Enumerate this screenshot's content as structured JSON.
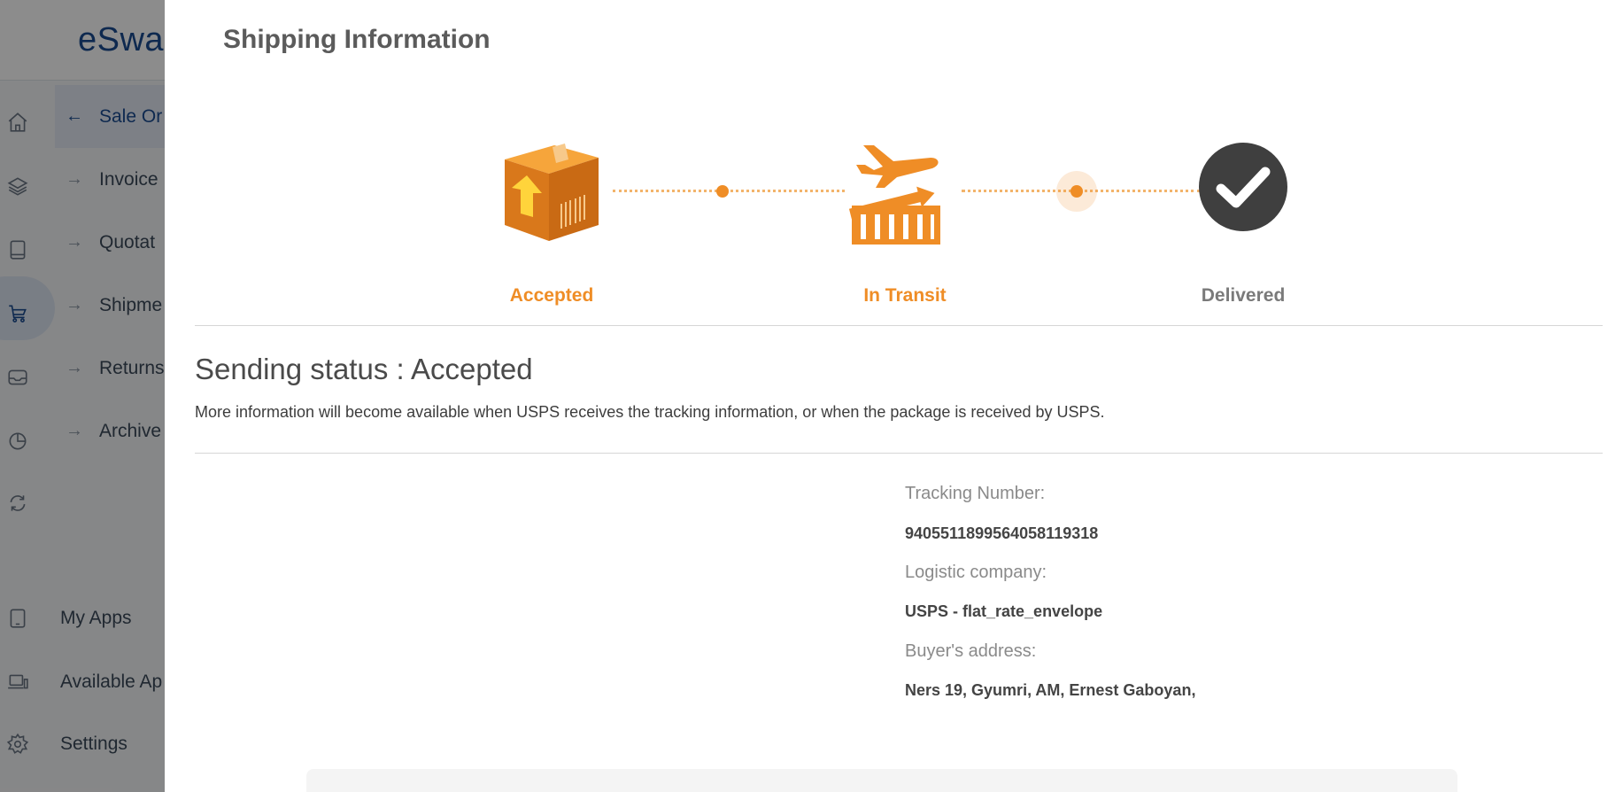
{
  "app": {
    "logo": "eSwa",
    "subnav": [
      {
        "label": "Sale Or",
        "active": true
      },
      {
        "label": "Invoice",
        "active": false
      },
      {
        "label": "Quotat",
        "active": false
      },
      {
        "label": "Shipme",
        "active": false
      },
      {
        "label": "Returns",
        "active": false
      },
      {
        "label": "Archive",
        "active": false
      }
    ],
    "bottom_nav": [
      {
        "label": "My Apps",
        "icon": "tablet-icon"
      },
      {
        "label": "Available Ap",
        "icon": "laptop-icon"
      },
      {
        "label": "Settings",
        "icon": "gear-icon"
      }
    ]
  },
  "modal": {
    "title": "Shipping Information",
    "steps": [
      {
        "label": "Accepted",
        "icon": "package-icon",
        "color": "#ef8d26"
      },
      {
        "label": "In Transit",
        "icon": "airplane-cargo-icon",
        "color": "#ef8d26"
      },
      {
        "label": "Delivered",
        "icon": "check-circle-icon",
        "color": "#6b6b6b"
      }
    ],
    "status_title": "Sending status : Accepted",
    "status_description": "More information will become available when USPS receives the tracking information, or when the package is received by USPS.",
    "details": {
      "tracking_label": "Tracking Number:",
      "tracking_value": "9405511899564058119318",
      "logistic_label": "Logistic company:",
      "logistic_value": "USPS - flat_rate_envelope",
      "address_label": "Buyer's address:",
      "address_value": "Ners 19, Gyumri, AM, Ernest Gaboyan,"
    }
  },
  "colors": {
    "accent": "#ef8d26",
    "brand": "#1b4b91",
    "delivered": "#3f3f3f"
  }
}
